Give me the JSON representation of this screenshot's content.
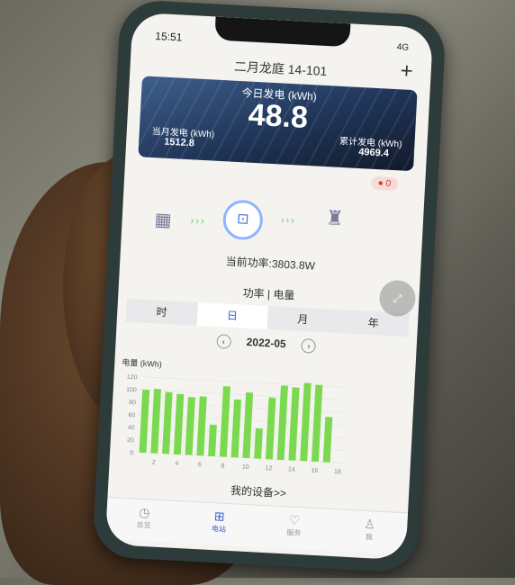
{
  "status": {
    "time": "15:51",
    "signal": "4G"
  },
  "header": {
    "title": "二月龙庭 14-101",
    "add_label": "+"
  },
  "banner": {
    "today_label": "今日发电 (kWh)",
    "today_value": "48.8",
    "month_label": "当月发电 (kWh)",
    "month_value": "1512.8",
    "total_label": "累计发电 (kWh)",
    "total_value": "4969.4"
  },
  "alarm_badge": "0",
  "current_power": "当前功率:3803.8W",
  "section_title": "功率 | 电量",
  "tabs": [
    "时",
    "日",
    "月",
    "年"
  ],
  "active_tab": "日",
  "date": "2022-05",
  "my_devices": "我的设备>>",
  "nav": [
    {
      "label": "总览",
      "icon": "clock-icon"
    },
    {
      "label": "电站",
      "icon": "station-icon"
    },
    {
      "label": "服务",
      "icon": "heart-icon"
    },
    {
      "label": "我",
      "icon": "person-icon"
    }
  ],
  "colors": {
    "accent": "#3b62d6",
    "bar": "#7ad94f"
  },
  "chart_data": {
    "type": "bar",
    "ylabel": "电量 (kWh)",
    "ylim": [
      0,
      120
    ],
    "yticks": [
      0,
      20,
      40,
      60,
      80,
      100,
      120
    ],
    "xticks": [
      2,
      4,
      6,
      8,
      10,
      12,
      14,
      16,
      18
    ],
    "categories": [
      1,
      2,
      3,
      4,
      5,
      6,
      7,
      8,
      9,
      10,
      11,
      12,
      13,
      14,
      15,
      16,
      17,
      18
    ],
    "values": [
      100,
      102,
      98,
      96,
      92,
      94,
      50,
      112,
      92,
      104,
      48,
      98,
      118,
      116,
      124,
      122,
      72,
      0
    ]
  }
}
